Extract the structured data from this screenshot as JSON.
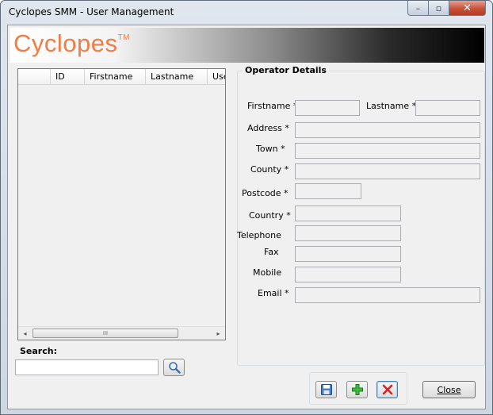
{
  "window": {
    "title": "Cyclopes SMM - User Management",
    "controls": {
      "minimize": "–",
      "maximize": "▫",
      "close": "✕"
    }
  },
  "banner": {
    "logo_text": "Cyclopes",
    "logo_tm": "TM",
    "logo_color": "#f07c46"
  },
  "grid": {
    "columns": [
      "ID",
      "Firstname",
      "Lastname",
      "Use"
    ],
    "rows": [],
    "scroll_left": "◂",
    "scroll_right": "▸",
    "scroll_thumb": "III"
  },
  "search": {
    "label": "Search:",
    "value": "",
    "button_icon": "magnifier-icon"
  },
  "operator_details": {
    "title": "Operator Details",
    "fields": {
      "firstname": {
        "label": "Firstname",
        "required": "*",
        "value": ""
      },
      "lastname": {
        "label": "Lastname",
        "required": "*",
        "value": ""
      },
      "address": {
        "label": "Address",
        "required": "*",
        "value": ""
      },
      "town": {
        "label": "Town",
        "required": "*",
        "value": ""
      },
      "county": {
        "label": "County",
        "required": "*",
        "value": ""
      },
      "postcode": {
        "label": "Postcode",
        "required": "*",
        "value": ""
      },
      "country": {
        "label": "Country",
        "required": "*",
        "value": ""
      },
      "telephone": {
        "label": "Telephone",
        "value": ""
      },
      "fax": {
        "label": "Fax",
        "value": ""
      },
      "mobile": {
        "label": "Mobile",
        "value": ""
      },
      "email": {
        "label": "Email",
        "required": "*",
        "value": ""
      }
    }
  },
  "actions": {
    "save_icon": "floppy-disk-icon",
    "add_icon": "green-plus-icon",
    "delete_icon": "red-x-icon",
    "close_label": "Close"
  }
}
